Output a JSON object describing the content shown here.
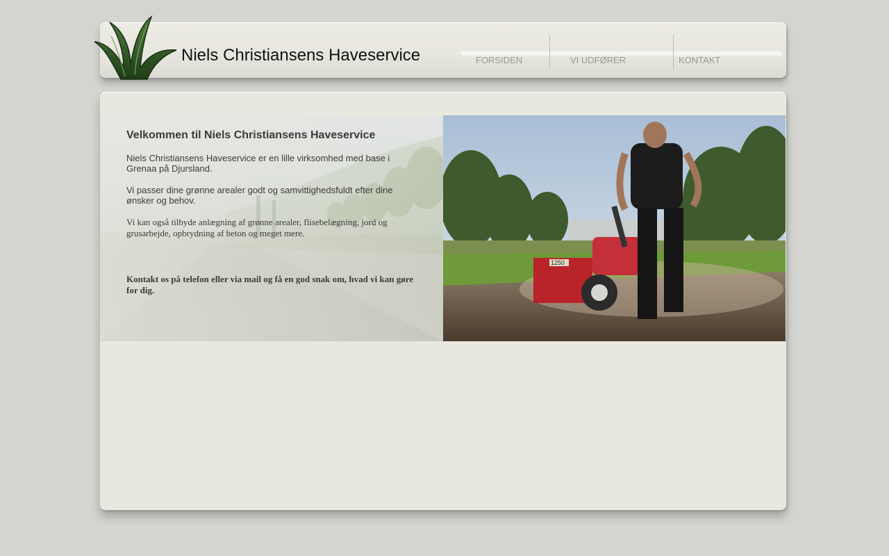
{
  "header": {
    "site_title": "Niels Christiansens Haveservice",
    "logo_icon": "grass-leaf-logo-icon"
  },
  "nav": {
    "items": [
      {
        "label": "FORSIDEN"
      },
      {
        "label": "VI UDFØRER"
      },
      {
        "label": "KONTAKT"
      }
    ]
  },
  "main": {
    "heading": "Velkommen til Niels Christiansens Haveservice",
    "paragraph_1": "Niels Christiansens Haveservice er en lille virksomhed med base i Grenaa på Djursland.",
    "paragraph_2": "Vi passer dine grønne arealer godt og samvittighedsfuldt efter dine ønsker og behov.",
    "paragraph_3": "Vi kan også tilbyde anlægning af grønne arealer, flisebelægning, jord og grusarbejde, opbrydning af beton og meget mere.",
    "paragraph_4": "Kontakt os på telefon eller via mail og få en god snak om, hvad vi kan gøre for dig.",
    "photo_machine_label": "1250"
  },
  "colors": {
    "page_bg": "#d4d5d0",
    "panel_bg": "#e8e8e0",
    "logo_green": "#2f5a24",
    "nav_text": "#9a9a96"
  }
}
